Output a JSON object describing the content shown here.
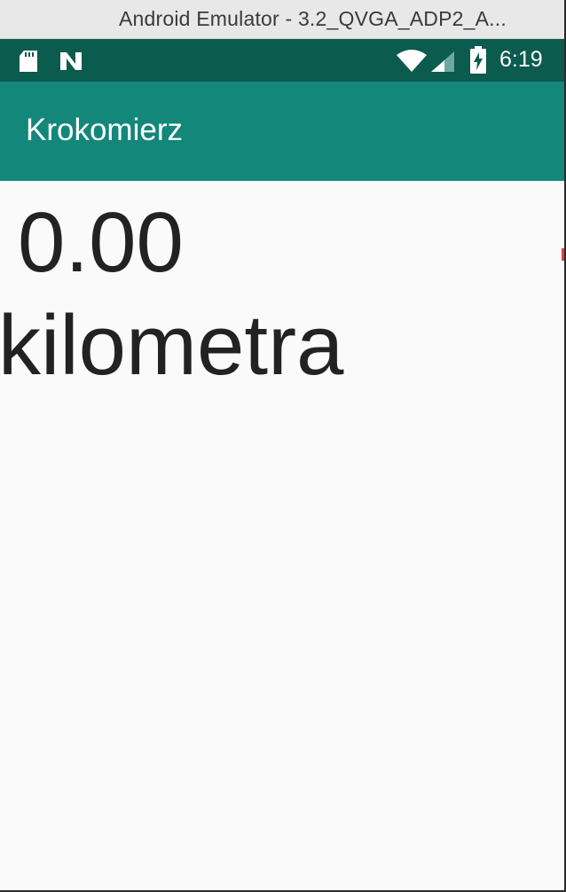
{
  "window": {
    "title": "Android Emulator - 3.2_QVGA_ADP2_A..."
  },
  "status_bar": {
    "icons": [
      "sd-card-icon",
      "n-notification-icon",
      "wifi-icon",
      "cell-signal-icon",
      "battery-charging-icon"
    ],
    "time": "6:19",
    "background_color": "#0b5b4e"
  },
  "app_bar": {
    "title": "Krokomierz",
    "background_color": "#12877a"
  },
  "content": {
    "distance_value": "0.00",
    "distance_unit": "kilometra",
    "background_color": "#fafafa"
  }
}
